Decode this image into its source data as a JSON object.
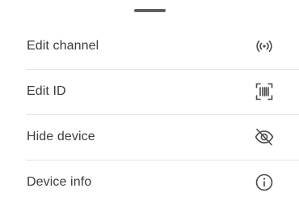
{
  "sheet": {
    "items": [
      {
        "label": "Edit channel",
        "icon": "broadcast-icon"
      },
      {
        "label": "Edit ID",
        "icon": "barcode-scan-icon"
      },
      {
        "label": "Hide device",
        "icon": "eye-off-icon"
      },
      {
        "label": "Device info",
        "icon": "info-icon"
      }
    ]
  },
  "colors": {
    "text": "#3d3d3d",
    "icon": "#4a4a4a",
    "divider": "#e3e3e3",
    "handle": "#5f5f5f"
  }
}
